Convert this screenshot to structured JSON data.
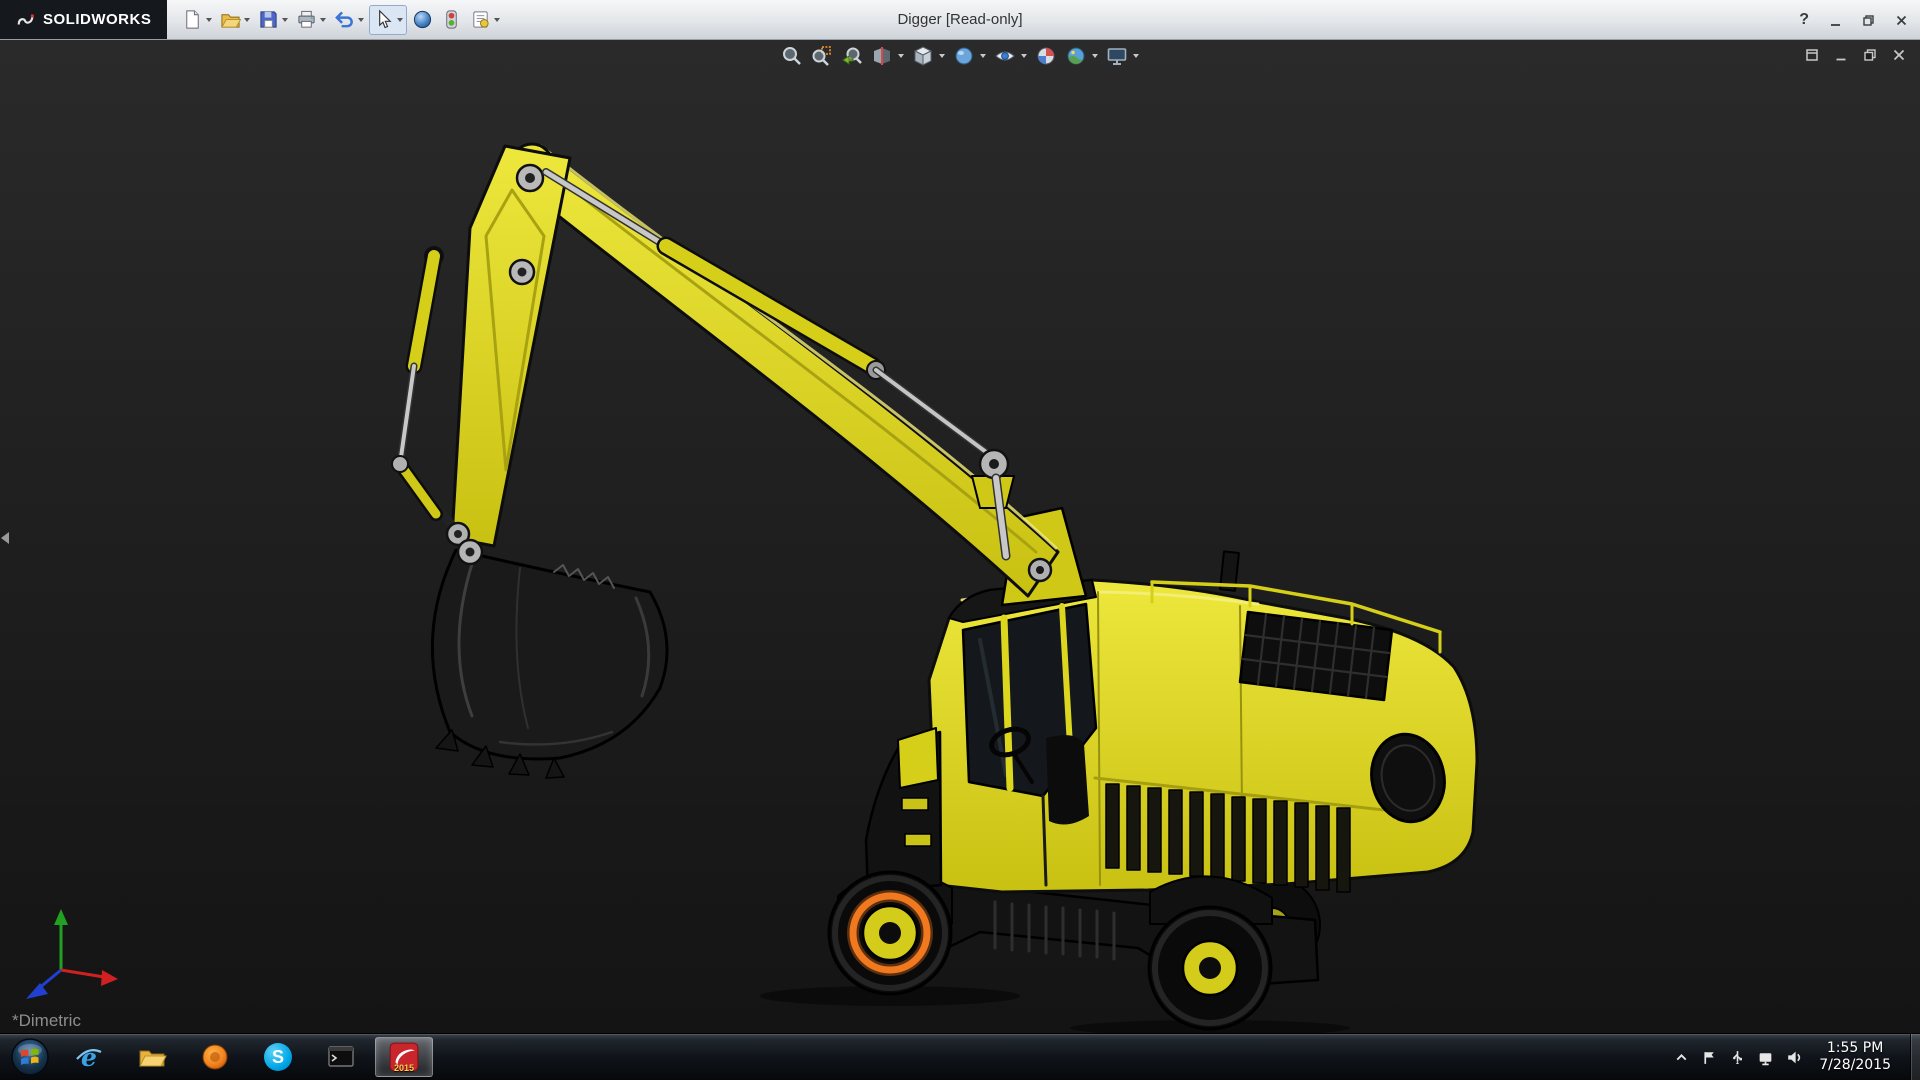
{
  "colors": {
    "model_yellow": "#ddd61e",
    "selection_highlight_orange": "#f0781e",
    "viewport_background_dark": "#1d1d1d"
  },
  "title_bar": {
    "brand": "SOLIDWORKS",
    "document_title": "Digger [Read-only]",
    "help_glyph": "?"
  },
  "viewport": {
    "view_orientation_label": "*Dimetric"
  },
  "taskbar": {
    "ie_glyph": "e",
    "skype_glyph": "S",
    "solidworks_badge": "2015",
    "clock": {
      "time": "1:55 PM",
      "date": "7/28/2015"
    }
  }
}
